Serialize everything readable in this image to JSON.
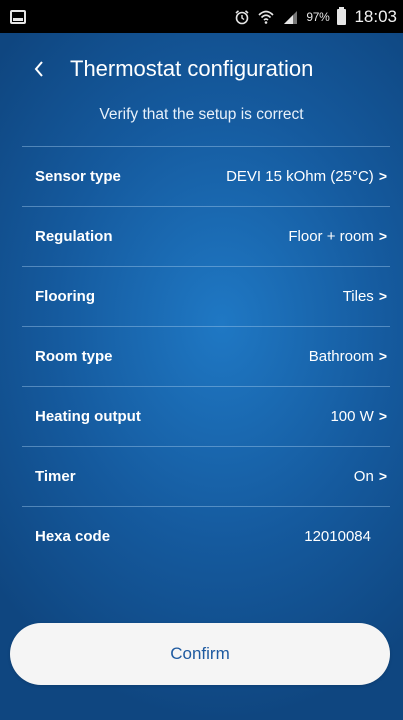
{
  "status_bar": {
    "battery_pct": "97%",
    "time": "18:03"
  },
  "header": {
    "title": "Thermostat configuration"
  },
  "subtitle": "Verify that the setup is correct",
  "settings": [
    {
      "label": "Sensor type",
      "value": "DEVI 15 kOhm (25°C)",
      "chevron": ">"
    },
    {
      "label": "Regulation",
      "value": "Floor + room",
      "chevron": ">"
    },
    {
      "label": "Flooring",
      "value": "Tiles",
      "chevron": ">"
    },
    {
      "label": "Room type",
      "value": "Bathroom",
      "chevron": ">"
    },
    {
      "label": "Heating output",
      "value": "100 W",
      "chevron": ">"
    },
    {
      "label": "Timer",
      "value": "On",
      "chevron": ">"
    },
    {
      "label": "Hexa code",
      "value": "12010084"
    }
  ],
  "confirm_label": "Confirm",
  "colors": {
    "background": "#155a9e",
    "button_text": "#1e5aa0"
  }
}
